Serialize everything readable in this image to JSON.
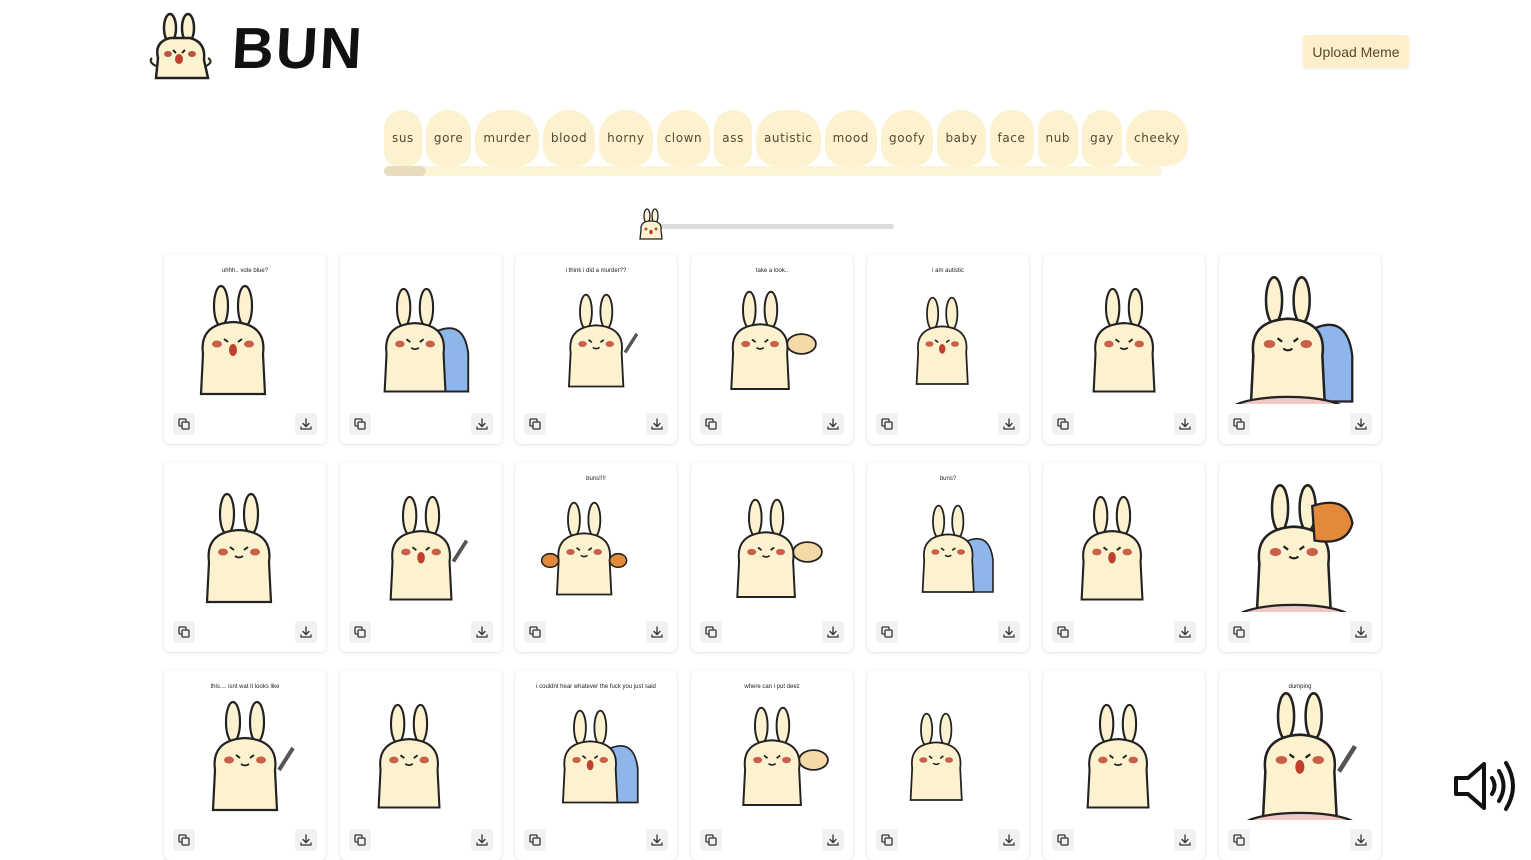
{
  "header": {
    "logo_text": "BUN",
    "upload_label": "Upload Meme"
  },
  "tags": [
    "sus",
    "gore",
    "murder",
    "blood",
    "horny",
    "clown",
    "ass",
    "autistic",
    "mood",
    "goofy",
    "baby",
    "face",
    "nub",
    "gay",
    "cheeky"
  ],
  "volume": {
    "level": 0
  },
  "memes": [
    {
      "caption": "uhhh.. vote blue?",
      "icon": "among-us-bunny"
    },
    {
      "caption": "",
      "icon": "bunny-with-blue-cat"
    },
    {
      "caption": "i think i did a murder??",
      "icon": "bunny-with-knife"
    },
    {
      "caption": "take a look..",
      "icon": "bunny-butt"
    },
    {
      "caption": "i am autistic",
      "icon": "bunny-standing"
    },
    {
      "caption": "",
      "icon": "bunny-baby-bottle"
    },
    {
      "caption": "",
      "icon": "bunny-face"
    },
    {
      "caption": "",
      "icon": "bunny-stool-cat"
    },
    {
      "caption": "",
      "icon": "bunny-face-blue"
    },
    {
      "caption": "buns!!!!",
      "icon": "bunny-buns"
    },
    {
      "caption": "",
      "icon": "bunny-muscles"
    },
    {
      "caption": "buns?",
      "icon": "bunny-mirror"
    },
    {
      "caption": "",
      "icon": "bunny-chopsticks"
    },
    {
      "caption": "",
      "icon": "bunny-carrot"
    },
    {
      "caption": "this.... isnt wat it looks like",
      "icon": "bunny-cat-pile"
    },
    {
      "caption": "",
      "icon": "bunny-bag"
    },
    {
      "caption": "i couldnt hear whatever the fuck you just said",
      "icon": "bunny-back"
    },
    {
      "caption": "where can i put deez",
      "icon": "bunny-hedgehog"
    },
    {
      "caption": "",
      "icon": "bunny-hammer"
    },
    {
      "caption": "",
      "icon": "bunny-ghost"
    },
    {
      "caption": "dumping",
      "icon": "bunny-dumping"
    }
  ]
}
